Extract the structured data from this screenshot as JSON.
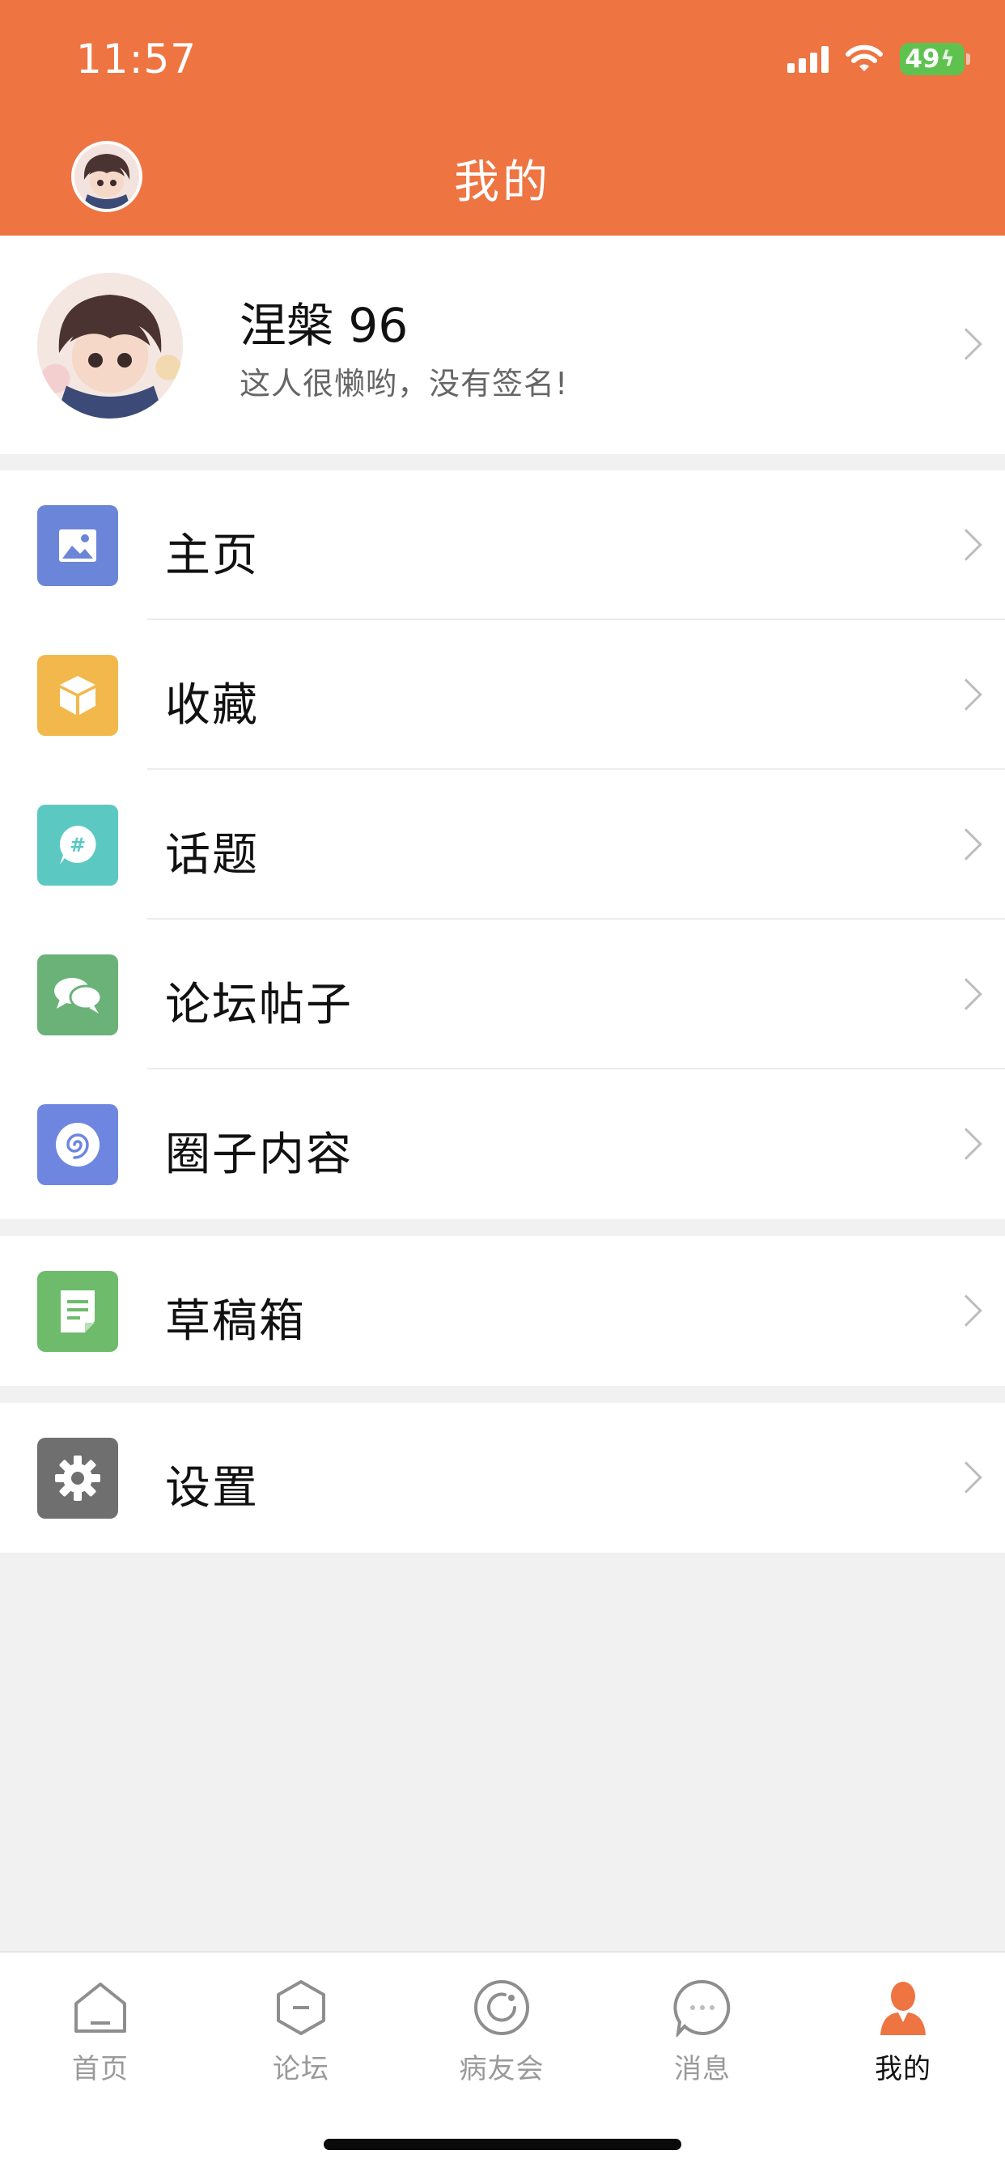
{
  "status_bar": {
    "time": "11:57",
    "battery": "49"
  },
  "header": {
    "title": "我的"
  },
  "profile": {
    "name": "涅槃 96",
    "signature": "这人很懒哟，没有签名!"
  },
  "menu_groups": [
    {
      "items": [
        {
          "label": "主页",
          "icon": "image-icon",
          "color": "#6b86d8"
        },
        {
          "label": "收藏",
          "icon": "box-icon",
          "color": "#f2b84b"
        },
        {
          "label": "话题",
          "icon": "topic-bubble-icon",
          "color": "#5cc8c2"
        },
        {
          "label": "论坛帖子",
          "icon": "chat-bubbles-icon",
          "color": "#6ab278"
        },
        {
          "label": "圈子内容",
          "icon": "circle-spiral-icon",
          "color": "#6e86e0"
        }
      ]
    },
    {
      "items": [
        {
          "label": "草稿箱",
          "icon": "draft-note-icon",
          "color": "#6dbb6b"
        }
      ]
    },
    {
      "items": [
        {
          "label": "设置",
          "icon": "gear-icon",
          "color": "#6f6f6f"
        }
      ]
    }
  ],
  "tabbar": {
    "items": [
      {
        "label": "首页",
        "icon": "home-icon",
        "active": false
      },
      {
        "label": "论坛",
        "icon": "forum-icon",
        "active": false
      },
      {
        "label": "病友会",
        "icon": "community-icon",
        "active": false
      },
      {
        "label": "消息",
        "icon": "message-icon",
        "active": false
      },
      {
        "label": "我的",
        "icon": "person-icon",
        "active": true
      }
    ],
    "active_color": "#ee7442"
  }
}
